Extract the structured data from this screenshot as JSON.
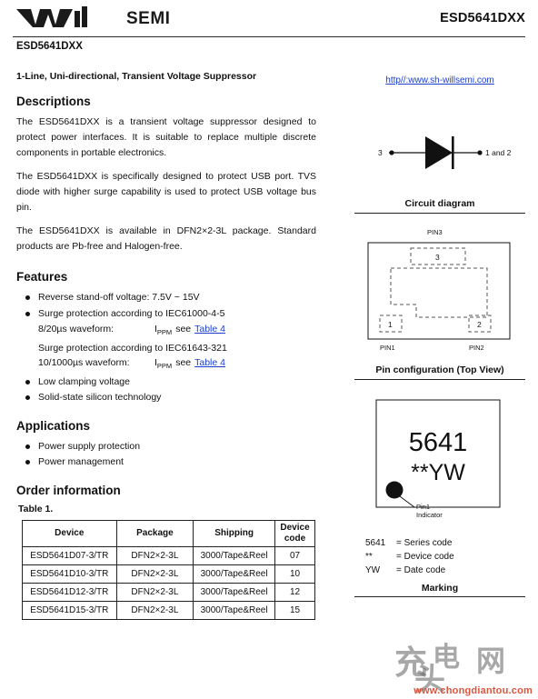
{
  "header": {
    "logo_text": "SEMI",
    "logo_mark": "will-wave-logo",
    "part_number": "ESD5641DXX",
    "part_number_sub": "ESD5641DXX"
  },
  "left": {
    "tagline": "1-Line, Uni-directional, Transient Voltage Suppressor",
    "descriptions_title": "Descriptions",
    "paragraphs": [
      "The ESD5641DXX is a transient voltage suppressor designed to protect power interfaces. It is suitable to replace multiple discrete components in portable electronics.",
      "The ESD5641DXX is specifically designed to protect USB port. TVS diode with higher surge capability is used to protect USB voltage bus pin.",
      "The ESD5641DXX is available in DFN2×2-3L package. Standard products are Pb-free and Halogen-free."
    ],
    "features_title": "Features",
    "features": [
      "Reverse stand-off voltage:  7.5V ~ 15V",
      "Surge protection according to IEC61000-4-5",
      "Low clamping voltage",
      "Solid-state silicon technology"
    ],
    "feature_sub_1": {
      "label": "8/20µs waveform:",
      "symbol": "I",
      "symbol_sub": "PPM",
      "see": "see",
      "link": "Table 4"
    },
    "feature_line_2": "Surge protection according to IEC61643-321",
    "feature_sub_2": {
      "label": "10/1000µs waveform:",
      "symbol": "I",
      "symbol_sub": "PPM",
      "see": "see",
      "link": "Table 4"
    },
    "applications_title": "Applications",
    "applications": [
      "Power supply protection",
      "Power management"
    ],
    "order_title": "Order information",
    "table_label": "Table 1.",
    "table": {
      "headers": [
        "Device",
        "Package",
        "Shipping",
        "Device code"
      ],
      "header_device_code_line1": "Device",
      "header_device_code_line2": "code",
      "rows": [
        [
          "ESD5641D07-3/TR",
          "DFN2×2-3L",
          "3000/Tape&Reel",
          "07"
        ],
        [
          "ESD5641D10-3/TR",
          "DFN2×2-3L",
          "3000/Tape&Reel",
          "10"
        ],
        [
          "ESD5641D12-3/TR",
          "DFN2×2-3L",
          "3000/Tape&Reel",
          "12"
        ],
        [
          "ESD5641D15-3/TR",
          "DFN2×2-3L",
          "3000/Tape&Reel",
          "15"
        ]
      ]
    }
  },
  "right": {
    "url": "http//:www.sh-willsemi.com",
    "circuit": {
      "caption": "Circuit diagram",
      "pin_left": "3",
      "pin_right": "1 and 2"
    },
    "pinconfig": {
      "caption": "Pin configuration (Top View)",
      "pin_top": "PIN3",
      "pad_top_num": "3",
      "pad_bl_num": "1",
      "pad_br_num": "2",
      "label_bl": "PIN1",
      "label_br": "PIN2"
    },
    "marking": {
      "line1": "5641",
      "line2": "**YW",
      "pin1_label_line1": "Pin1",
      "pin1_label_line2": "Indicator",
      "caption": "Marking",
      "legend": [
        {
          "key": "5641",
          "value": "= Series code"
        },
        {
          "key": "**",
          "value": "= Device code"
        },
        {
          "key": "YW",
          "value": "= Date code"
        }
      ]
    }
  },
  "watermark": {
    "chars": [
      "充",
      "电",
      "头",
      "网"
    ],
    "url": "www.chongdiantou.com"
  }
}
